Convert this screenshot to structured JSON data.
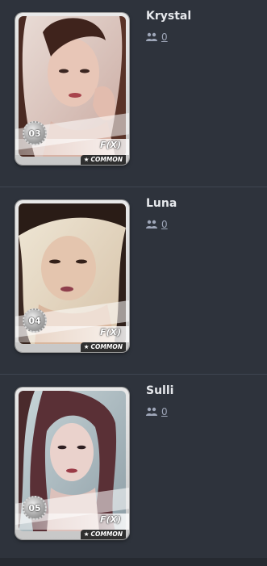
{
  "cards": [
    {
      "name": "Krystal",
      "member_count": "0",
      "number": "03",
      "group": "F(X)",
      "rarity": "COMMON"
    },
    {
      "name": "Luna",
      "member_count": "0",
      "number": "04",
      "group": "F(X)",
      "rarity": "COMMON"
    },
    {
      "name": "Sulli",
      "member_count": "0",
      "number": "05",
      "group": "F(X)",
      "rarity": "COMMON"
    }
  ],
  "icons": {
    "members": "users-icon",
    "rarity": "star-icon"
  },
  "colors": {
    "background": "#2e333c",
    "divider": "#3f4550",
    "name_text": "#e6e8ec",
    "link_text": "#9ea6b8"
  }
}
